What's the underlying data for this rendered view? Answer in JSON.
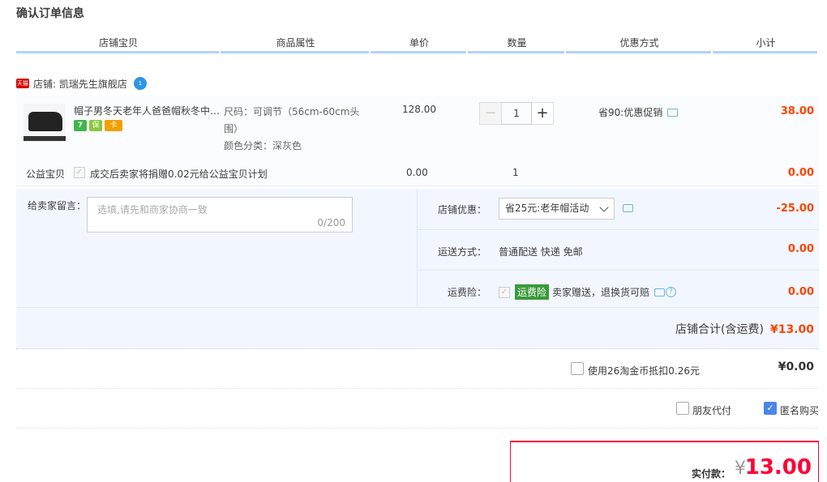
{
  "page_title": "确认订单信息",
  "columns": [
    "店铺宝贝",
    "商品属性",
    "单价",
    "数量",
    "优惠方式",
    "小计"
  ],
  "shop": {
    "badge": "天猫",
    "label": "店铺: 凯瑞先生旗舰店",
    "wangwang": "1"
  },
  "item": {
    "title": "帽子男冬天老年人爸爸帽秋冬中…",
    "service_icons": [
      "7",
      "保",
      "卡"
    ],
    "attr_size_line1": "尺码：可调节（56cm-60cm头",
    "attr_size_line2": "围）",
    "attr_color": "颜色分类：深灰色",
    "price": "128.00",
    "qty": "1",
    "qty_minus": "−",
    "qty_plus": "+",
    "promo": "省90:优惠促销",
    "subtotal": "38.00"
  },
  "charity": {
    "label": "公益宝贝",
    "text": "成交后卖家将捐赠0.02元给公益宝贝计划",
    "price": "0.00",
    "qty": "1",
    "subtotal": "0.00"
  },
  "message": {
    "label": "给卖家留言：",
    "placeholder": "选填,请先和商家协商一致",
    "counter": "0/200"
  },
  "shop_discount": {
    "label": "店铺优惠：",
    "selected": "省25元:老年帽活动",
    "value": "-25.00"
  },
  "shipping": {
    "label": "运送方式：",
    "text": "普通配送 快递 免邮",
    "value": "0.00"
  },
  "insurance": {
    "label": "运费险：",
    "badge": "运费险",
    "text": "卖家赠送，退换货可赔",
    "value": "0.00"
  },
  "shop_total": {
    "label": "店铺合计(含运费)",
    "value": "¥13.00"
  },
  "coins": {
    "text": "使用26淘金币抵扣0.26元",
    "value": "¥0.00"
  },
  "friend_pay": {
    "label": "朋友代付"
  },
  "anonymous": {
    "label": "匿名购买"
  },
  "final": {
    "label": "实付款：",
    "yen": "¥",
    "amount": "13.00"
  },
  "colors": {
    "accent": "#ff0036",
    "price_red": "#ff4400",
    "header_bar": "#b2d1ff",
    "order_bg": "#f2f7ff"
  }
}
